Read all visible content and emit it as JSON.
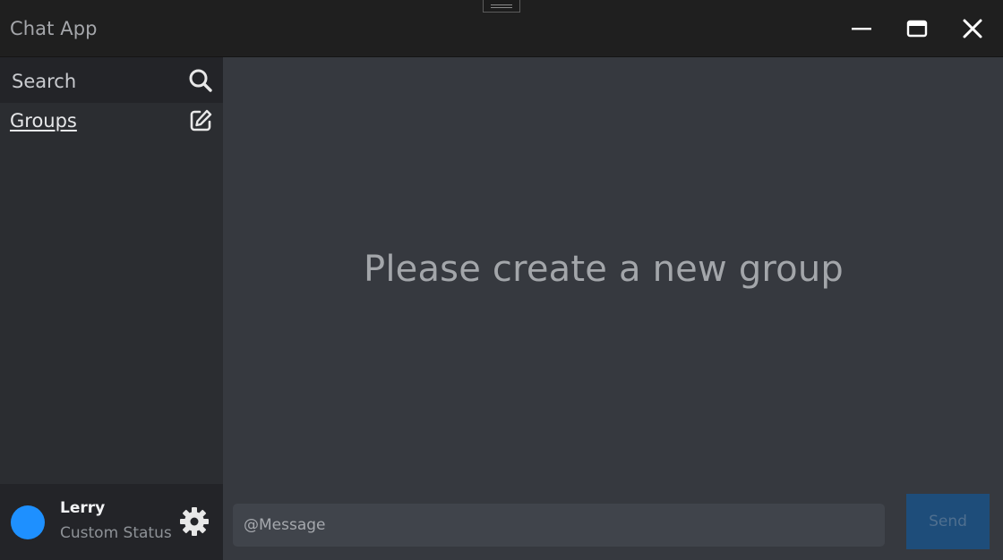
{
  "window": {
    "title": "Chat App"
  },
  "titlebar": {
    "minimize_icon": "minimize-icon",
    "maximize_icon": "maximize-icon",
    "close_icon": "close-icon"
  },
  "sidebar": {
    "search_label": "Search",
    "search_icon": "search-icon",
    "groups_label": "Groups",
    "new_group_icon": "edit-icon"
  },
  "user": {
    "name": "Lerry",
    "status": "Custom Status",
    "avatar_color": "#1e90ff",
    "settings_icon": "gear-icon"
  },
  "main": {
    "empty_message": "Please create a new group",
    "message_placeholder": "@Message",
    "send_label": "Send"
  },
  "colors": {
    "titlebar_bg": "#1f1f1f",
    "sidebar_bg": "#2b2d31",
    "panel_bg": "#232428",
    "main_bg": "#36393f",
    "input_bg": "#40444b",
    "send_bg": "#1e4d7a"
  }
}
